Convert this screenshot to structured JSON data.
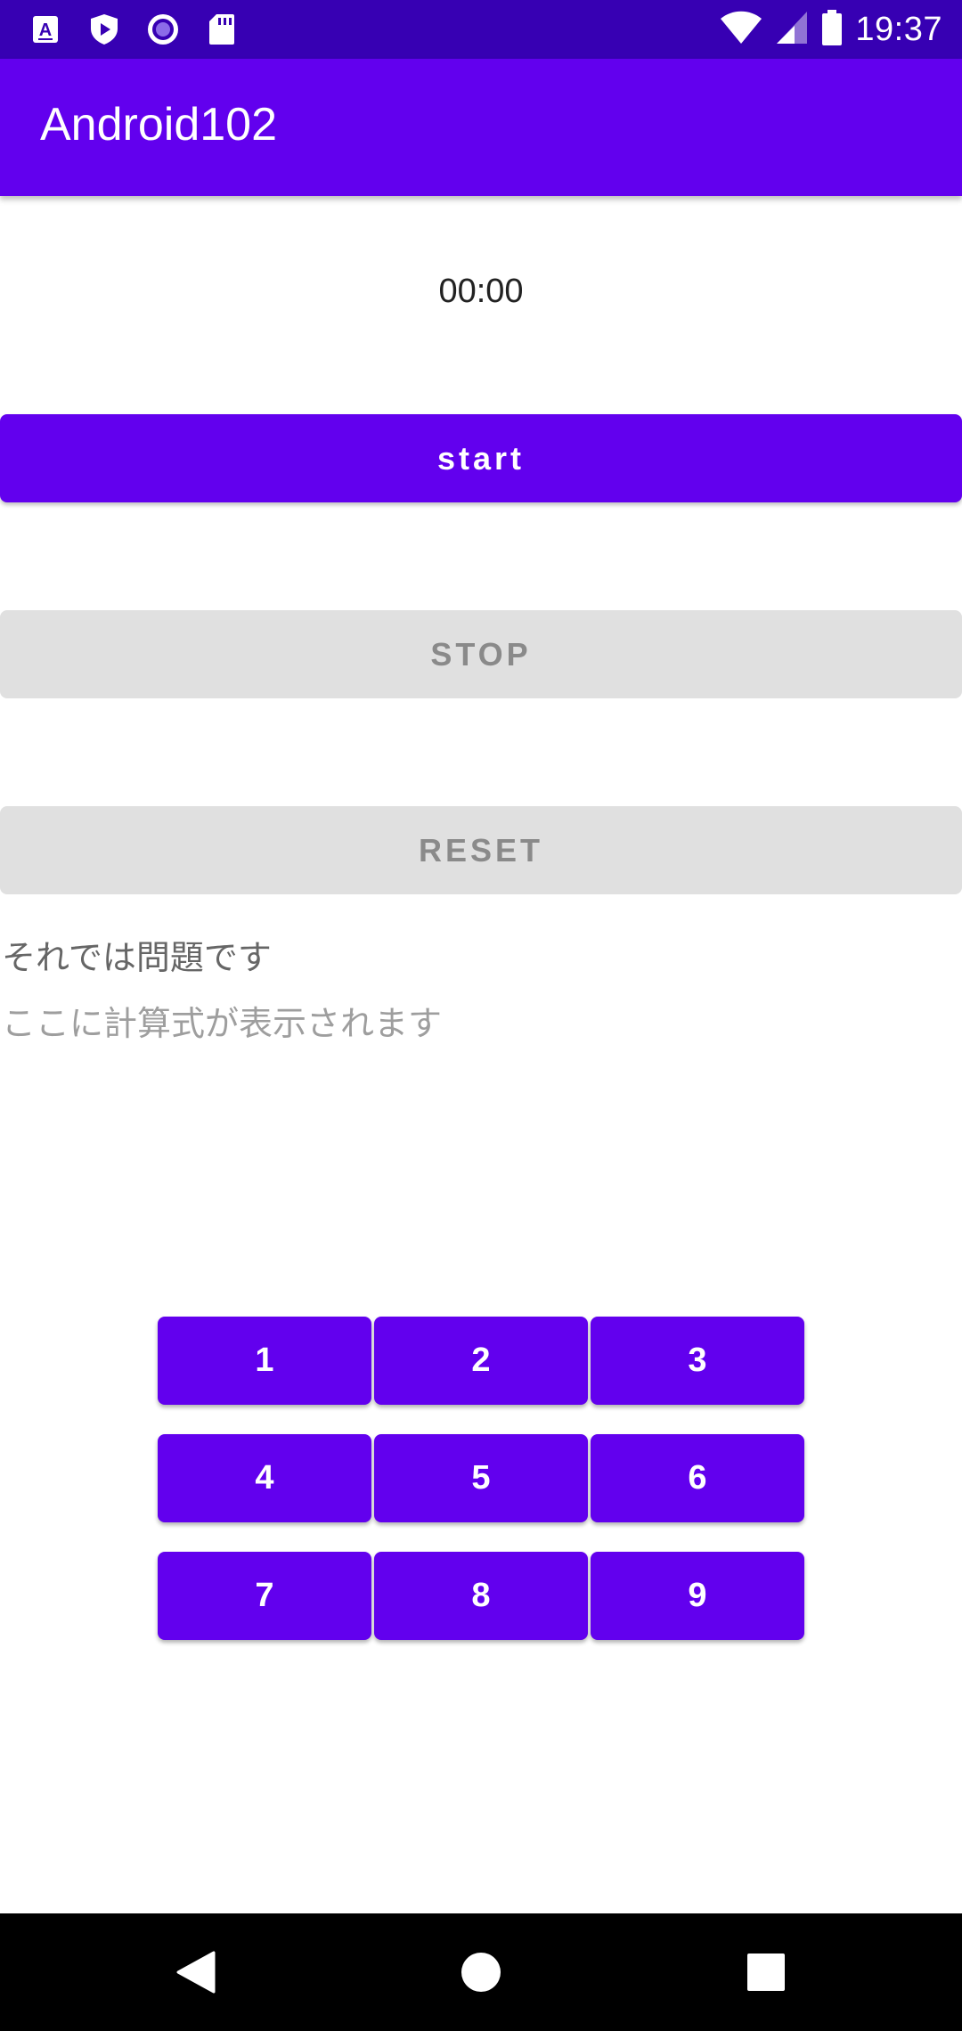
{
  "status_bar": {
    "time": "19:37",
    "left_icons": [
      "notification-a-icon",
      "shield-play-icon",
      "circle-record-icon",
      "sd-card-icon"
    ],
    "right_icons": [
      "wifi-icon",
      "cellular-signal-icon",
      "battery-icon"
    ]
  },
  "app_bar": {
    "title": "Android102"
  },
  "timer": {
    "value": "00:00"
  },
  "controls": {
    "start_label": "start",
    "stop_label": "STOP",
    "reset_label": "RESET"
  },
  "question": {
    "label": "それでは問題です",
    "formula_placeholder": "ここに計算式が表示されます"
  },
  "keypad": {
    "keys": [
      "1",
      "2",
      "3",
      "4",
      "5",
      "6",
      "7",
      "8",
      "9"
    ]
  },
  "nav_bar": {
    "icons": [
      "back-icon",
      "home-icon",
      "recents-icon"
    ]
  },
  "colors": {
    "primary": "#6200EE",
    "primary_dark": "#3700B3",
    "disabled_bg": "#E0E0E0",
    "disabled_text": "#8A8A8A",
    "on_primary": "#FFFFFF"
  }
}
